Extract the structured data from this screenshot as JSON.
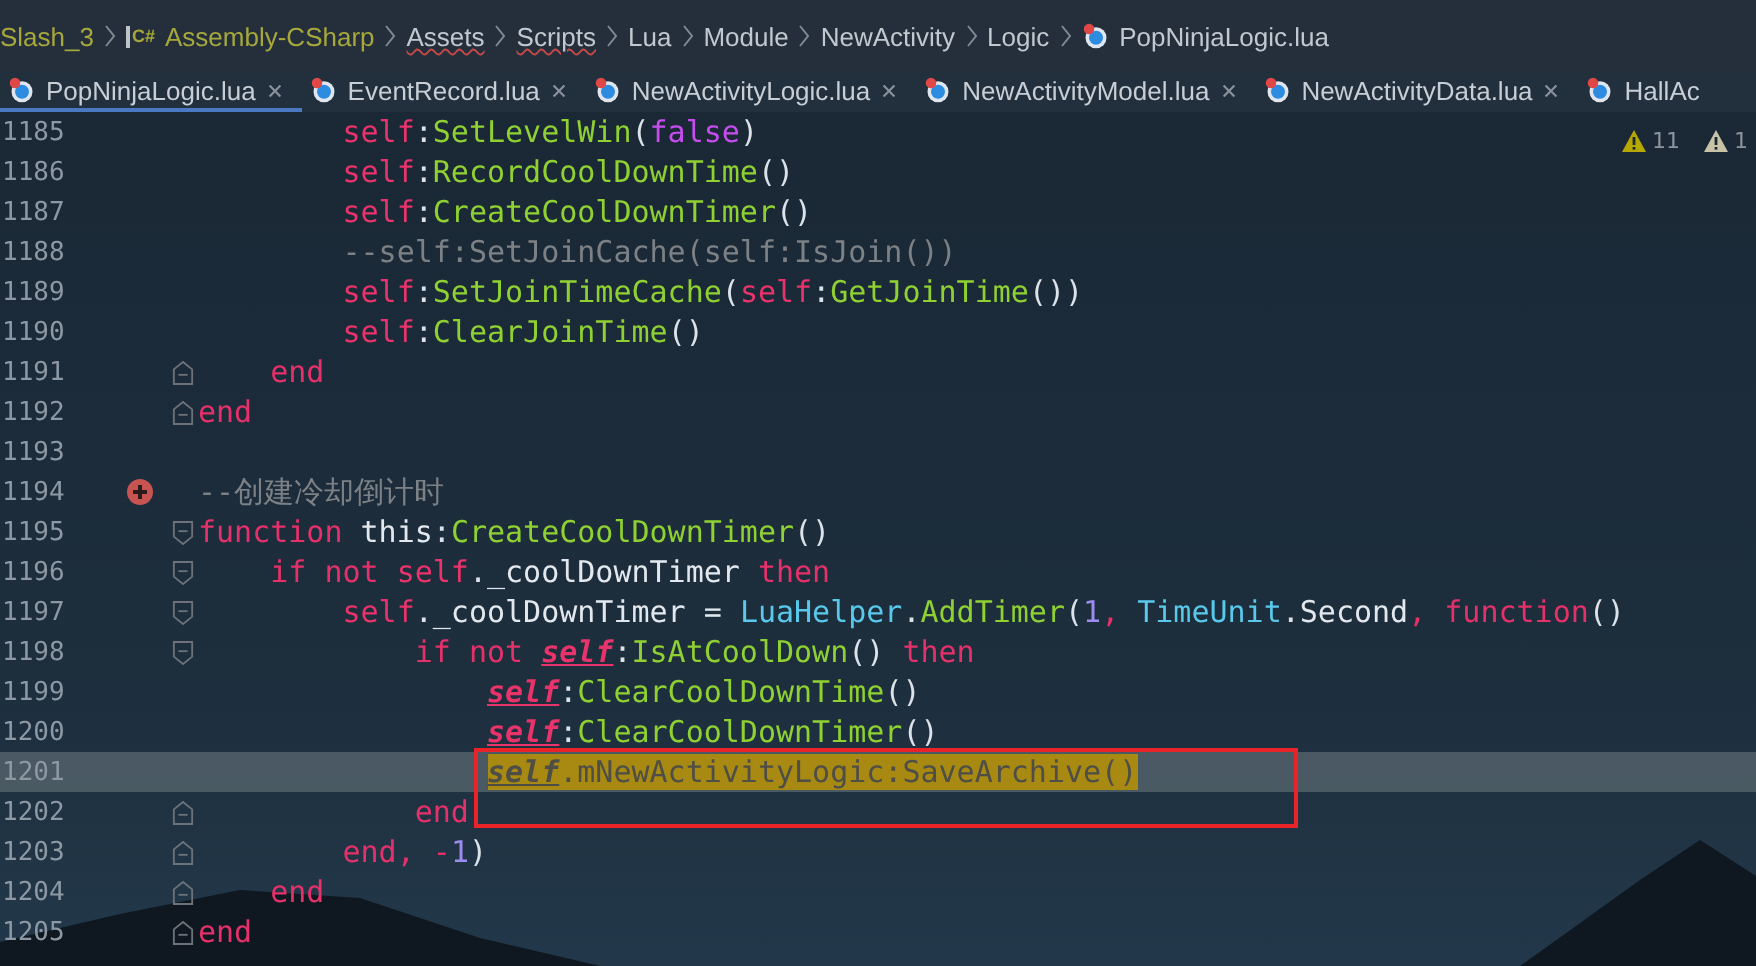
{
  "breadcrumb": [
    {
      "kind": "project",
      "label": "Slash_3",
      "typo": false
    },
    {
      "kind": "assembly",
      "badge": "C#",
      "label": "Assembly-CSharp",
      "typo": false
    },
    {
      "kind": "folder",
      "label": "Assets",
      "typo": true
    },
    {
      "kind": "folder",
      "label": "Scripts",
      "typo": true
    },
    {
      "kind": "folder",
      "label": "Lua",
      "typo": false
    },
    {
      "kind": "folder",
      "label": "Module",
      "typo": false
    },
    {
      "kind": "folder",
      "label": "NewActivity",
      "typo": false
    },
    {
      "kind": "folder",
      "label": "Logic",
      "typo": false
    },
    {
      "kind": "file",
      "label": "PopNinjaLogic.lua",
      "typo": false
    }
  ],
  "tabs": [
    {
      "label": "PopNinjaLogic.lua",
      "selected": true,
      "closable": true
    },
    {
      "label": "EventRecord.lua",
      "selected": false,
      "closable": true
    },
    {
      "label": "NewActivityLogic.lua",
      "selected": false,
      "closable": true
    },
    {
      "label": "NewActivityModel.lua",
      "selected": false,
      "closable": true
    },
    {
      "label": "NewActivityData.lua",
      "selected": false,
      "closable": true
    },
    {
      "label": "HallAc",
      "selected": false,
      "closable": false
    }
  ],
  "inspections": [
    {
      "kind": "warning",
      "count": "11"
    },
    {
      "kind": "weak_warning",
      "count": "1"
    }
  ],
  "lines": [
    {
      "number": "1185",
      "current": false,
      "tokens": [
        {
          "kind": "self",
          "t": "        self"
        },
        {
          "kind": "punct",
          "t": ":"
        },
        {
          "kind": "method",
          "t": "SetLevelWin"
        },
        {
          "kind": "punct",
          "t": "("
        },
        {
          "kind": "bool",
          "t": "false"
        },
        {
          "kind": "punct",
          "t": ")"
        }
      ]
    },
    {
      "number": "1186",
      "current": false,
      "tokens": [
        {
          "kind": "self",
          "t": "        self"
        },
        {
          "kind": "punct",
          "t": ":"
        },
        {
          "kind": "method",
          "t": "RecordCoolDownTime"
        },
        {
          "kind": "punct",
          "t": "()"
        }
      ]
    },
    {
      "number": "1187",
      "current": false,
      "tokens": [
        {
          "kind": "self",
          "t": "        self"
        },
        {
          "kind": "punct",
          "t": ":"
        },
        {
          "kind": "method",
          "t": "CreateCoolDownTimer"
        },
        {
          "kind": "punct",
          "t": "()"
        }
      ]
    },
    {
      "number": "1188",
      "current": false,
      "tokens": [
        {
          "kind": "comment",
          "t": "        --self:SetJoinCache(self:IsJoin())"
        }
      ]
    },
    {
      "number": "1189",
      "current": false,
      "tokens": [
        {
          "kind": "self",
          "t": "        self"
        },
        {
          "kind": "punct",
          "t": ":"
        },
        {
          "kind": "method",
          "t": "SetJoinTimeCache"
        },
        {
          "kind": "punct",
          "t": "("
        },
        {
          "kind": "self",
          "t": "self"
        },
        {
          "kind": "punct",
          "t": ":"
        },
        {
          "kind": "method",
          "t": "GetJoinTime"
        },
        {
          "kind": "punct",
          "t": "())"
        }
      ]
    },
    {
      "number": "1190",
      "current": false,
      "tokens": [
        {
          "kind": "self",
          "t": "        self"
        },
        {
          "kind": "punct",
          "t": ":"
        },
        {
          "kind": "method",
          "t": "ClearJoinTime"
        },
        {
          "kind": "punct",
          "t": "()"
        }
      ]
    },
    {
      "number": "1191",
      "current": false,
      "fold": {
        "kind": "end"
      },
      "tokens": [
        {
          "kind": "kw",
          "t": "    end"
        }
      ]
    },
    {
      "number": "1192",
      "current": false,
      "fold": {
        "kind": "end"
      },
      "tokens": [
        {
          "kind": "kw",
          "t": "end"
        }
      ]
    },
    {
      "number": "1193",
      "current": false
    },
    {
      "number": "1194",
      "current": false,
      "breakpoint": true,
      "tokens": [
        {
          "kind": "comment",
          "t": "--创建冷却倒计时"
        }
      ]
    },
    {
      "number": "1195",
      "current": false,
      "fold": {
        "kind": "start"
      },
      "tokens": [
        {
          "kind": "kw",
          "t": "function"
        },
        {
          "kind": "plain",
          "t": " this"
        },
        {
          "kind": "punct",
          "t": ":"
        },
        {
          "kind": "method",
          "t": "CreateCoolDownTimer"
        },
        {
          "kind": "punct",
          "t": "()"
        }
      ]
    },
    {
      "number": "1196",
      "current": false,
      "fold": {
        "kind": "start"
      },
      "tokens": [
        {
          "kind": "kw",
          "t": "    if not"
        },
        {
          "kind": "self",
          "t": " self"
        },
        {
          "kind": "punct",
          "t": "."
        },
        {
          "kind": "plain",
          "t": "_coolDownTimer "
        },
        {
          "kind": "kw",
          "t": "then"
        }
      ]
    },
    {
      "number": "1197",
      "current": false,
      "fold": {
        "kind": "start"
      },
      "tokens": [
        {
          "kind": "self",
          "t": "        self"
        },
        {
          "kind": "punct",
          "t": "."
        },
        {
          "kind": "plain",
          "t": "_coolDownTimer = "
        },
        {
          "kind": "class",
          "t": "LuaHelper"
        },
        {
          "kind": "punct",
          "t": "."
        },
        {
          "kind": "method",
          "t": "AddTimer"
        },
        {
          "kind": "punct",
          "t": "("
        },
        {
          "kind": "number",
          "t": "1"
        },
        {
          "kind": "kw",
          "t": ", "
        },
        {
          "kind": "class",
          "t": "TimeUnit"
        },
        {
          "kind": "punct",
          "t": "."
        },
        {
          "kind": "plain",
          "t": "Second"
        },
        {
          "kind": "kw",
          "t": ", function"
        },
        {
          "kind": "punct",
          "t": "()"
        }
      ]
    },
    {
      "number": "1198",
      "current": false,
      "fold": {
        "kind": "start"
      },
      "tokens": [
        {
          "kind": "kw",
          "t": "            if not "
        },
        {
          "kind": "selfref",
          "t": "self"
        },
        {
          "kind": "punct",
          "t": ":"
        },
        {
          "kind": "method",
          "t": "IsAtCoolDown"
        },
        {
          "kind": "punct",
          "t": "() "
        },
        {
          "kind": "kw",
          "t": "then"
        }
      ]
    },
    {
      "number": "1199",
      "current": false,
      "tokens": [
        {
          "kind": "selfref",
          "t": "                self"
        },
        {
          "kind": "punct",
          "t": ":"
        },
        {
          "kind": "method",
          "t": "ClearCoolDownTime"
        },
        {
          "kind": "punct",
          "t": "()"
        }
      ]
    },
    {
      "number": "1200",
      "current": false,
      "tokens": [
        {
          "kind": "selfref",
          "t": "                self"
        },
        {
          "kind": "punct",
          "t": ":"
        },
        {
          "kind": "method",
          "t": "ClearCoolDownTimer"
        },
        {
          "kind": "punct",
          "t": "()"
        }
      ]
    },
    {
      "number": "1201",
      "current": true,
      "tokens": [
        {
          "kind": "foundself",
          "t": "                self"
        },
        {
          "kind": "found",
          "t": ".mNewActivityLogic:SaveArchive()"
        }
      ]
    },
    {
      "number": "1202",
      "current": false,
      "fold": {
        "kind": "end"
      },
      "tokens": [
        {
          "kind": "kw",
          "t": "            end"
        }
      ]
    },
    {
      "number": "1203",
      "current": false,
      "fold": {
        "kind": "end"
      },
      "tokens": [
        {
          "kind": "kw",
          "t": "        end, "
        },
        {
          "kind": "kw",
          "t": "-"
        },
        {
          "kind": "number",
          "t": "1"
        },
        {
          "kind": "punct",
          "t": ")"
        }
      ]
    },
    {
      "number": "1204",
      "current": false,
      "fold": {
        "kind": "end"
      },
      "tokens": [
        {
          "kind": "kw",
          "t": "    end"
        }
      ]
    },
    {
      "number": "1205",
      "current": false,
      "fold": {
        "kind": "end"
      },
      "tokens": [
        {
          "kind": "kw",
          "t": "end"
        }
      ]
    }
  ]
}
